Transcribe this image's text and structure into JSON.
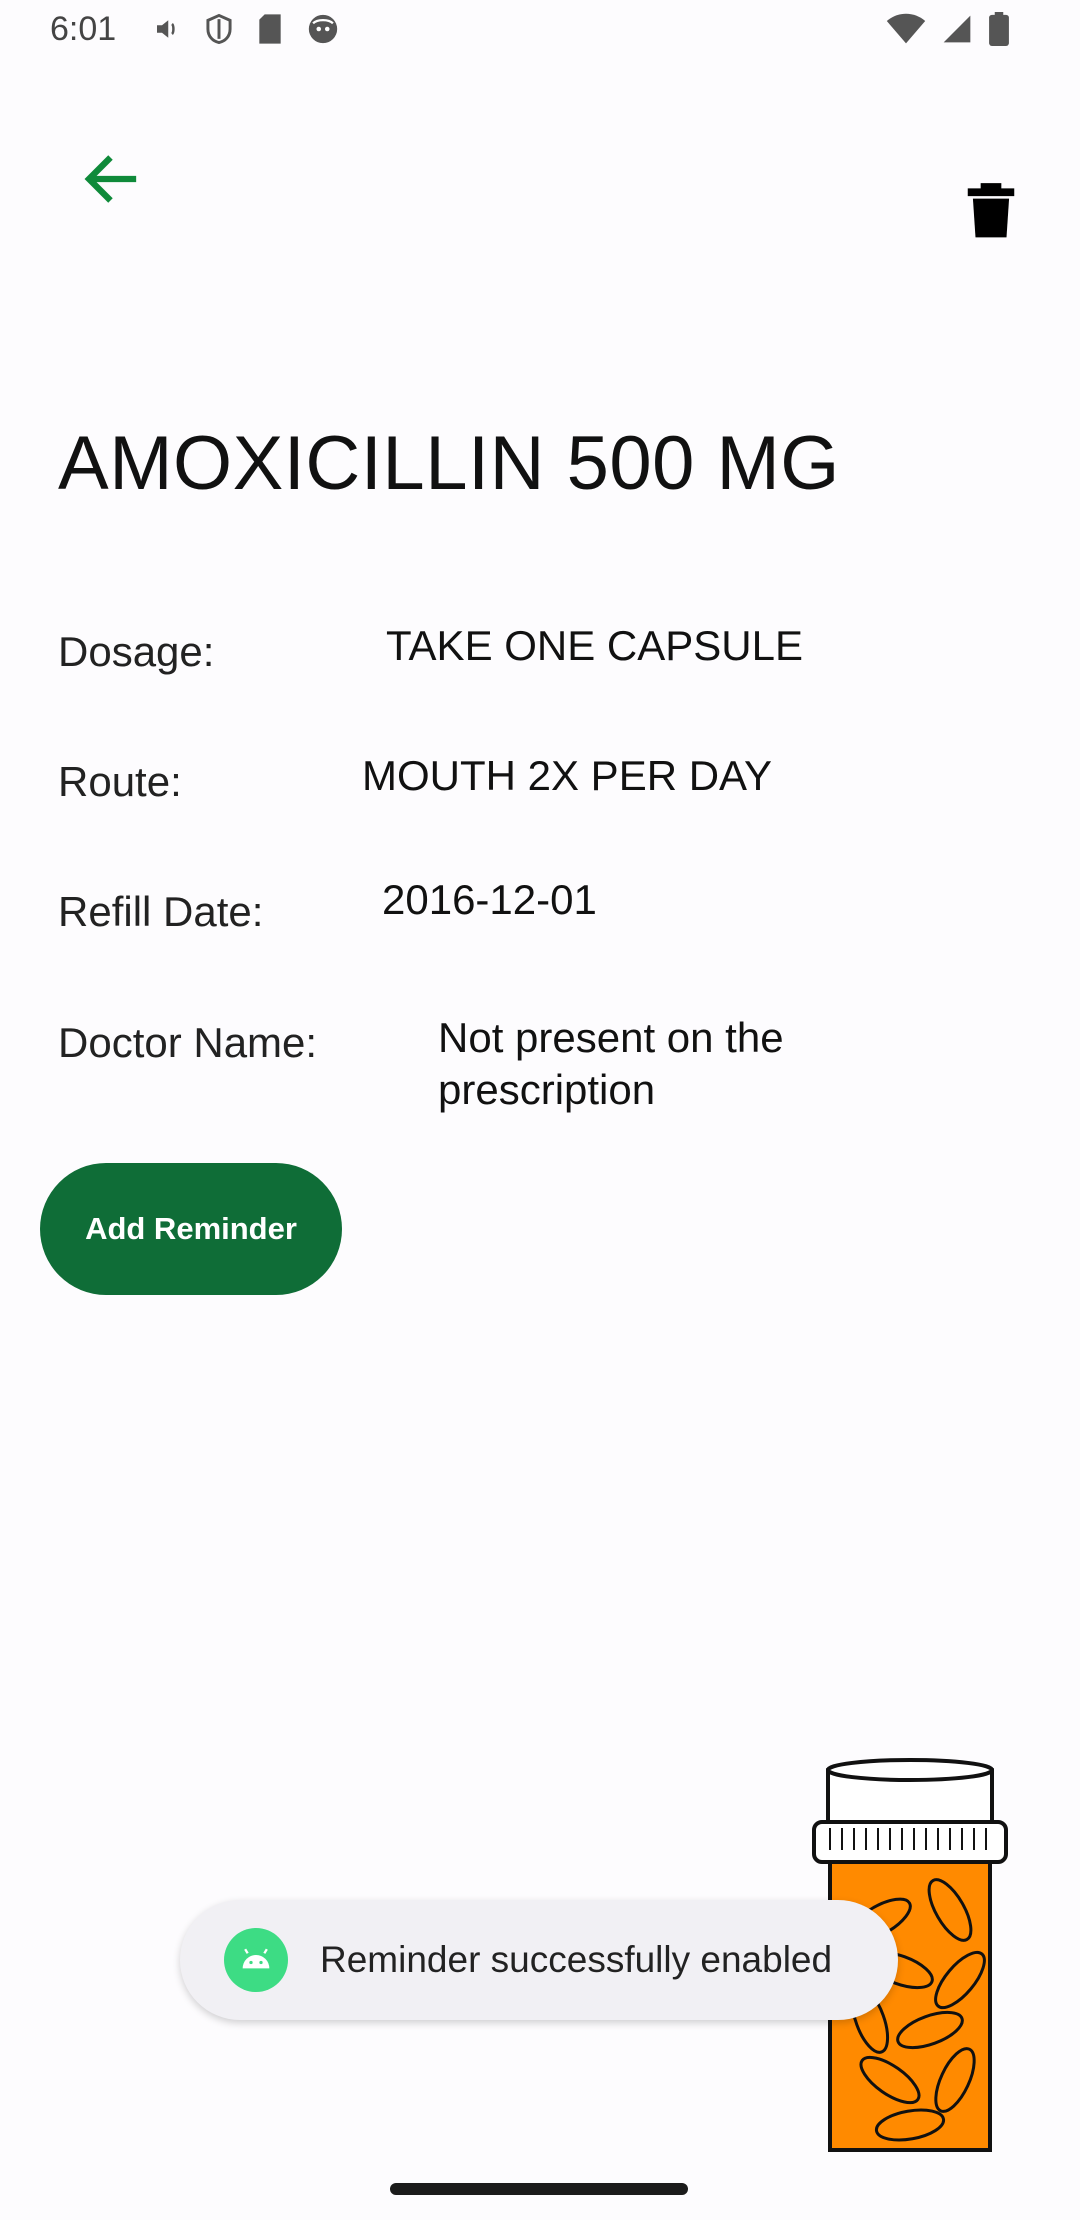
{
  "status_bar": {
    "time": "6:01",
    "left_icons": [
      "volume-icon",
      "shield-icon",
      "sd-card-icon",
      "face-icon"
    ],
    "right_icons": [
      "wifi-icon",
      "signal-icon",
      "battery-icon"
    ]
  },
  "toolbar": {
    "back_icon": "arrow-back-icon",
    "delete_icon": "trash-icon",
    "accent_color": "#0f8a3a"
  },
  "medication": {
    "name": "AMOXICILLIN 500 MG",
    "fields": [
      {
        "label": "Dosage:",
        "value": "TAKE ONE CAPSULE"
      },
      {
        "label": "Route:",
        "value": "MOUTH 2X PER DAY"
      },
      {
        "label": "Refill Date:",
        "value": "2016-12-01"
      },
      {
        "label": "Doctor Name:",
        "value_line1": "Not present on the",
        "value_line2": "prescription"
      }
    ]
  },
  "actions": {
    "add_reminder_label": "Add Reminder",
    "button_color": "#0f6d37"
  },
  "toast": {
    "message": "Reminder successfully enabled",
    "icon": "android-icon"
  }
}
